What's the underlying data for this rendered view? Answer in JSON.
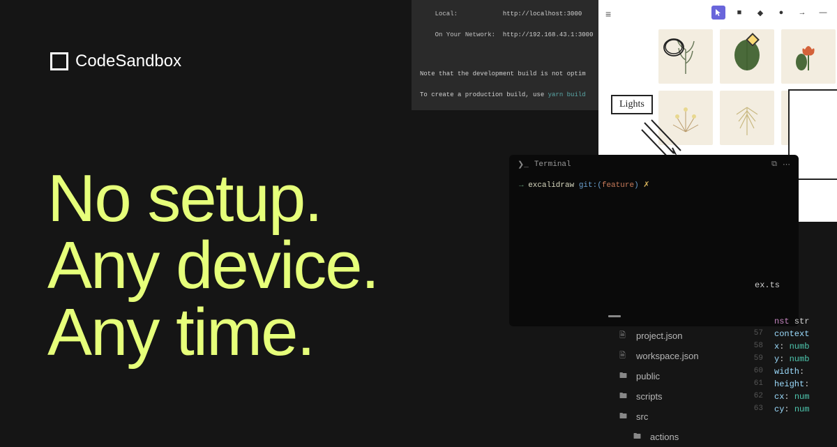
{
  "logo": {
    "text": "CodeSandbox"
  },
  "headline": {
    "line1": "No setup.",
    "line2": "Any device.",
    "line3": "Any time."
  },
  "top_terminal": {
    "local_label": "Local:",
    "local_url": "http://localhost:3000",
    "network_label": "On Your Network:",
    "network_url": "http://192.168.43.1:3000",
    "note_line1": "Note that the development build is not optim",
    "note_line2": "To create a production build, use ",
    "note_cmd": "yarn build"
  },
  "draw": {
    "label_lights": "Lights"
  },
  "terminal": {
    "title": "Terminal",
    "prompt": {
      "dir": "excalidraw",
      "git_prefix": "git:(",
      "branch": "feature",
      "git_suffix": ")",
      "dirty": "✗"
    }
  },
  "file_tree": {
    "items": [
      {
        "type": "file",
        "name": "project.json"
      },
      {
        "type": "file",
        "name": "workspace.json"
      },
      {
        "type": "folder",
        "name": "public"
      },
      {
        "type": "folder",
        "name": "scripts"
      },
      {
        "type": "folder",
        "name": "src"
      },
      {
        "type": "folder",
        "name": "actions"
      }
    ]
  },
  "code": {
    "filename": "ex.ts",
    "lines": [
      {
        "num": "",
        "kw": "nst",
        "rest": " str"
      },
      {
        "num": "57",
        "prop": "context"
      },
      {
        "num": "58",
        "prop": "x",
        "type": "numb"
      },
      {
        "num": "59",
        "prop": "y",
        "type": "numb"
      },
      {
        "num": "60",
        "prop": "width",
        "rest": ":"
      },
      {
        "num": "61",
        "prop": "height",
        "rest": ":"
      },
      {
        "num": "62",
        "prop": "cx",
        "type": "num"
      },
      {
        "num": "63",
        "prop": "cy",
        "type": "num"
      }
    ]
  }
}
